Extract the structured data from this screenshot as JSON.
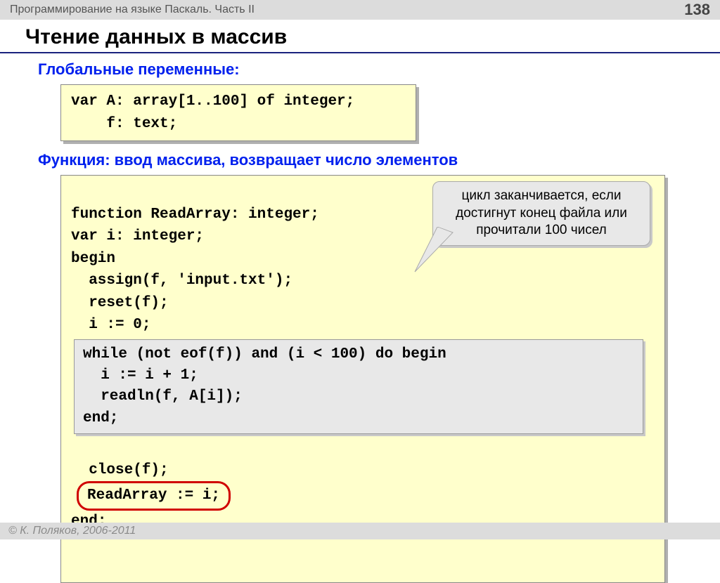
{
  "header": {
    "course": "Программирование на языке Паскаль. Часть II",
    "page": "138"
  },
  "title": "Чтение данных в массив",
  "section1": "Глобальные переменные:",
  "code1": "var A: array[1..100] of integer;\n    f: text;",
  "section2": "Функция: ввод массива, возвращает число элементов",
  "code2_pre": "function ReadArray: integer;\nvar i: integer;\nbegin\n  assign(f, 'input.txt');\n  reset(f);\n  i := 0;",
  "code2_inner": "while (not eof(f)) and (i < 100) do begin\n  i := i + 1;\n  readln(f, A[i]);\nend;",
  "code2_close": "  close(f);",
  "code2_highlight": "ReadArray := i;",
  "code2_end": "end;",
  "callout": "цикл заканчивается, если достигнут конец файла или прочитали 100 чисел",
  "footer": "© К. Поляков, 2006-2011"
}
